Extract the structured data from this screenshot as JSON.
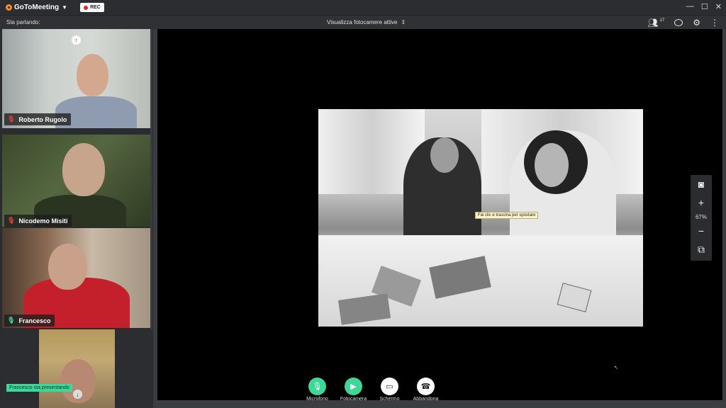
{
  "app": {
    "name": "GoToMeeting",
    "rec_label": "REC"
  },
  "window_controls": {
    "minimize": "—",
    "maximize": "☐",
    "close": "✕"
  },
  "toolbar": {
    "speaking_label": "Sta parlando:",
    "camera_select": "Visualizza fotocamere attive",
    "attendee_count": "17"
  },
  "participants": [
    {
      "name": "Roberto Rugolo",
      "muted": true
    },
    {
      "name": "Nicodemo Misiti",
      "muted": true
    },
    {
      "name": "Francesco",
      "muted": false
    },
    {
      "name": "",
      "muted": false
    }
  ],
  "presenting_banner": "Francesco sta presentando",
  "tooltip": "Fai clic e trascina per spostare",
  "zoom": {
    "percent": "67%"
  },
  "controls": [
    {
      "label": "Microfono",
      "icon": "microphone-icon"
    },
    {
      "label": "Fotocamera",
      "icon": "camera-icon"
    },
    {
      "label": "Schermo",
      "icon": "screen-share-icon"
    },
    {
      "label": "Abbandona",
      "icon": "hangup-icon"
    }
  ],
  "colors": {
    "accent": "#3fd69a",
    "muted": "#e0413b",
    "brand": "#f68d2e"
  }
}
